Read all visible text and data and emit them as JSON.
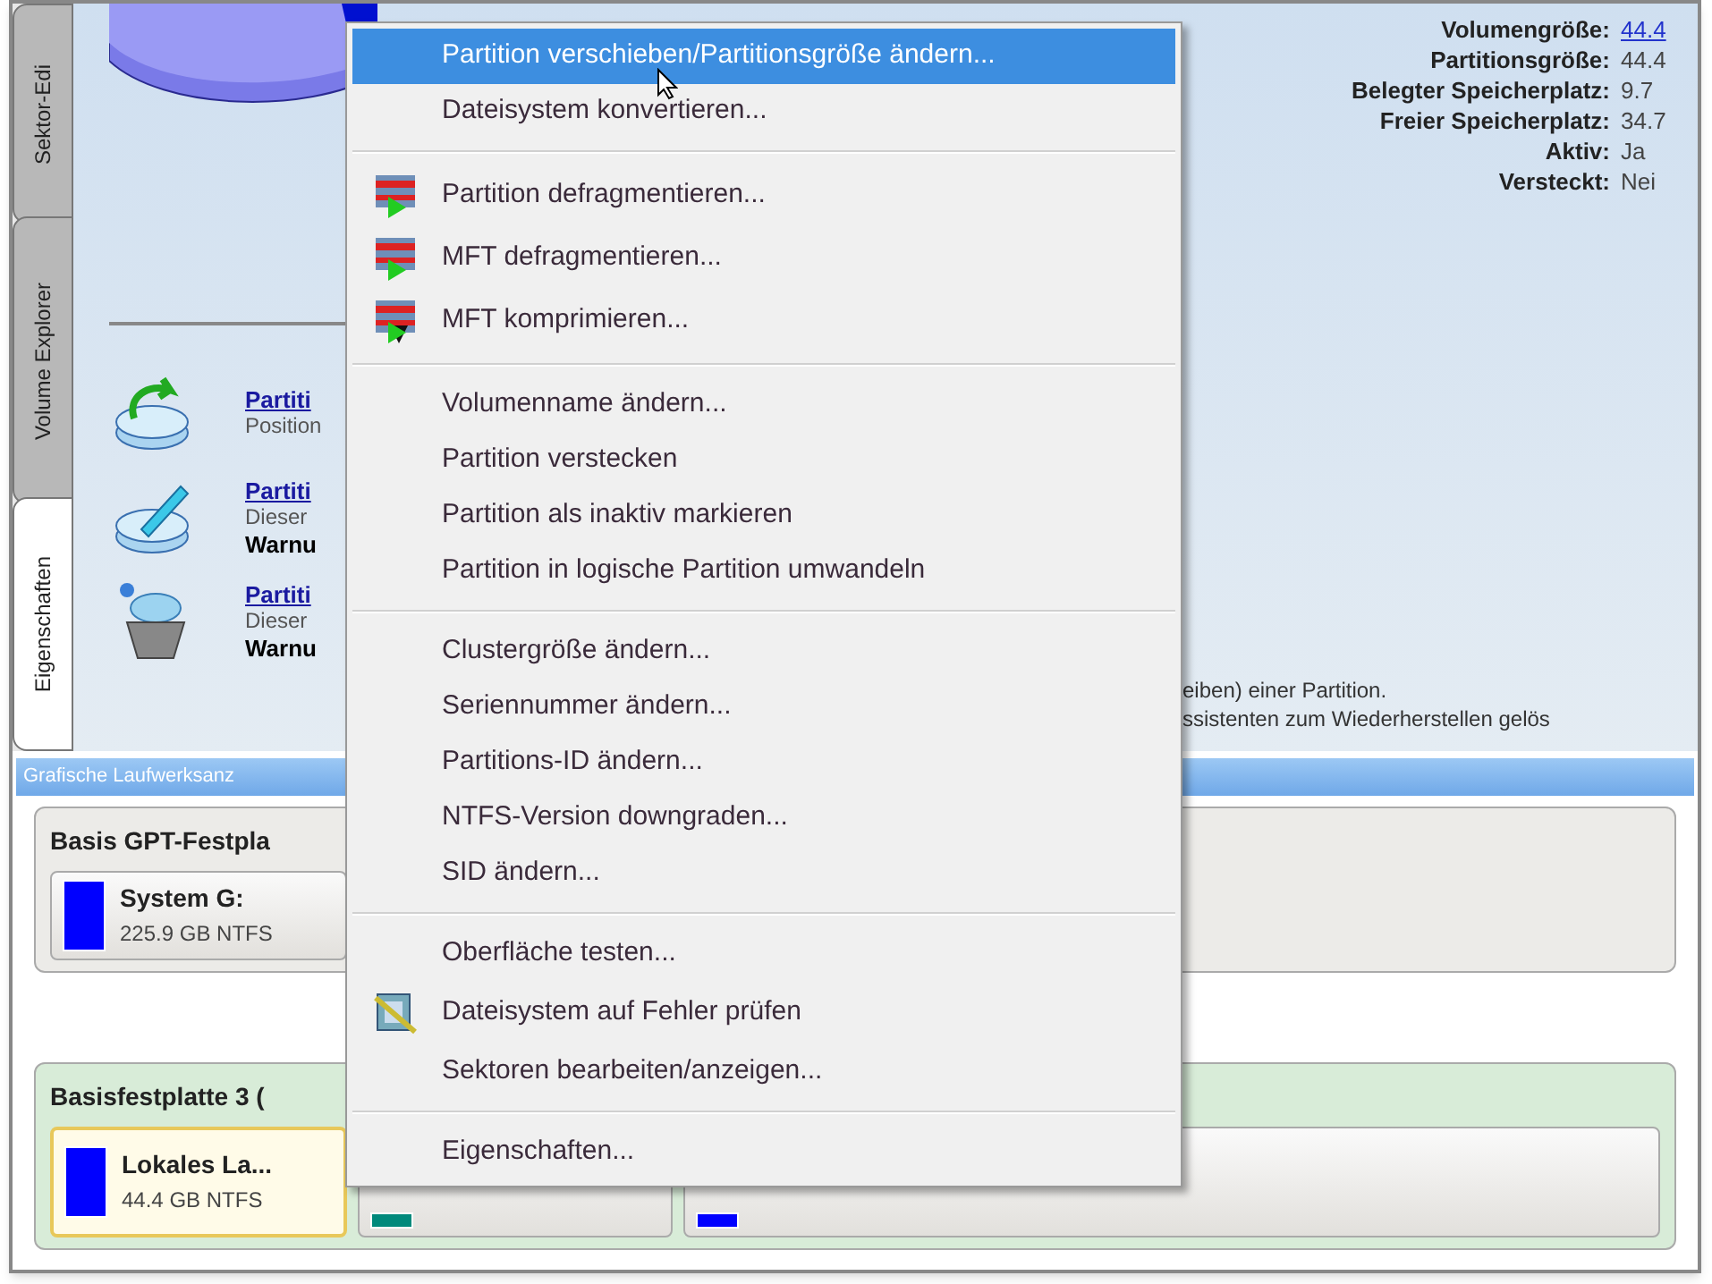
{
  "side_tabs": [
    {
      "label": "Sektor-Edi",
      "selected": false
    },
    {
      "label": "Volume Explorer",
      "selected": false
    },
    {
      "label": "Eigenschaften",
      "selected": true
    }
  ],
  "actions": [
    {
      "kind": "move",
      "link": "Partiti",
      "lines": [
        "Position"
      ]
    },
    {
      "kind": "edit",
      "link": "Partiti",
      "lines": [
        "Dieser",
        "Warnu"
      ]
    },
    {
      "kind": "recover",
      "link": "Partiti",
      "lines": [
        "Dieser",
        "Warnu"
      ]
    }
  ],
  "properties": [
    {
      "label": "Volumengröße:",
      "value": "44.4",
      "link": true
    },
    {
      "label": "Partitionsgröße:",
      "value": "44.4",
      "link": false
    },
    {
      "label": "Belegter Speicherplatz:",
      "value": "9.7",
      "link": false
    },
    {
      "label": "Freier Speicherplatz:",
      "value": "34.7",
      "link": false
    },
    {
      "label": "Aktiv:",
      "value": "Ja",
      "link": false
    },
    {
      "label": "Versteckt:",
      "value": "Nei",
      "link": false
    }
  ],
  "description_tail": [
    "eiben) einer Partition.",
    "ssistenten zum Wiederherstellen gelös"
  ],
  "disk_panel": {
    "title": "Grafische Laufwerksanz",
    "disks": [
      {
        "kind": "gpt",
        "title": "Basis GPT-Festpla",
        "partitions": [
          {
            "name": "System G:",
            "size": "225.9 GB NTFS",
            "color": "#0000ff",
            "selected": false
          }
        ]
      },
      {
        "kind": "basic",
        "title": "Basisfestplatte 3 (",
        "partitions": [
          {
            "name": "Lokales La...",
            "size": "44.4 GB NTFS",
            "color": "#0000ff",
            "selected": true
          },
          {
            "color": "#00897b",
            "selected": false
          },
          {
            "color": "#0000ff",
            "selected": false
          }
        ]
      }
    ]
  },
  "context_menu": {
    "groups": [
      [
        {
          "kind": "plain",
          "label": "Partition verschieben/Partitionsgröße ändern...",
          "selected": true
        },
        {
          "kind": "plain",
          "label": "Dateisystem konvertieren...",
          "selected": false
        }
      ],
      [
        {
          "kind": "defrag",
          "label": "Partition defragmentieren...",
          "selected": false
        },
        {
          "kind": "defrag",
          "label": "MFT defragmentieren...",
          "selected": false
        },
        {
          "kind": "compress",
          "label": "MFT komprimieren...",
          "selected": false
        }
      ],
      [
        {
          "kind": "plain",
          "label": "Volumenname ändern...",
          "selected": false
        },
        {
          "kind": "plain",
          "label": "Partition verstecken",
          "selected": false
        },
        {
          "kind": "plain",
          "label": "Partition als inaktiv markieren",
          "selected": false
        },
        {
          "kind": "plain",
          "label": "Partition in logische Partition umwandeln",
          "selected": false
        }
      ],
      [
        {
          "kind": "plain",
          "label": "Clustergröße ändern...",
          "selected": false
        },
        {
          "kind": "plain",
          "label": "Seriennummer ändern...",
          "selected": false
        },
        {
          "kind": "plain",
          "label": "Partitions-ID ändern...",
          "selected": false
        },
        {
          "kind": "plain",
          "label": "NTFS-Version downgraden...",
          "selected": false
        },
        {
          "kind": "plain",
          "label": "SID ändern...",
          "selected": false
        }
      ],
      [
        {
          "kind": "plain",
          "label": "Oberfläche testen...",
          "selected": false
        },
        {
          "kind": "check",
          "label": "Dateisystem auf Fehler prüfen",
          "selected": false
        },
        {
          "kind": "plain",
          "label": "Sektoren bearbeiten/anzeigen...",
          "selected": false
        }
      ],
      [
        {
          "kind": "plain",
          "label": "Eigenschaften...",
          "selected": false
        }
      ]
    ]
  }
}
